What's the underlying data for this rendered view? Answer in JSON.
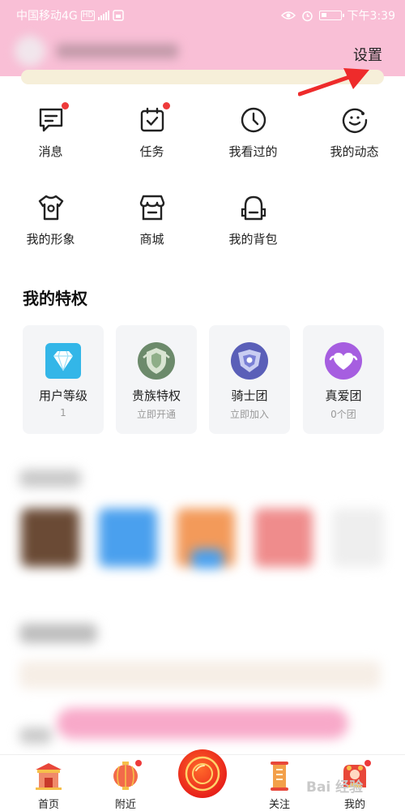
{
  "status_bar": {
    "carrier": "中国移动4G",
    "hd": "HD",
    "time": "下午3:39"
  },
  "header": {
    "settings_label": "设置"
  },
  "menu": [
    {
      "label": "消息",
      "icon": "message-icon",
      "dot": true
    },
    {
      "label": "任务",
      "icon": "task-icon",
      "dot": true
    },
    {
      "label": "我看过的",
      "icon": "history-clock-icon",
      "dot": false
    },
    {
      "label": "我的动态",
      "icon": "moments-icon",
      "dot": false
    },
    {
      "label": "我的形象",
      "icon": "avatar-shirt-icon",
      "dot": false
    },
    {
      "label": "商城",
      "icon": "shop-icon",
      "dot": false
    },
    {
      "label": "我的背包",
      "icon": "backpack-icon",
      "dot": false
    }
  ],
  "privileges": {
    "title": "我的特权",
    "cards": [
      {
        "label": "用户等级",
        "sub": "1",
        "icon": "diamond-icon",
        "color": "#33b6e8"
      },
      {
        "label": "贵族特权",
        "sub": "立即开通",
        "icon": "noble-shield-icon",
        "color": "#6c8a6b"
      },
      {
        "label": "骑士团",
        "sub": "立即加入",
        "icon": "knight-badge-icon",
        "color": "#5a5fb8"
      },
      {
        "label": "真爱团",
        "sub": "0个团",
        "icon": "heart-group-icon",
        "color": "#a65ee0"
      }
    ]
  },
  "bottom_nav": [
    {
      "label": "首页",
      "icon": "home-temple-icon",
      "dot": false
    },
    {
      "label": "附近",
      "icon": "nearby-lantern-icon",
      "dot": true
    },
    {
      "label": "",
      "icon": "live-camera-icon",
      "dot": false
    },
    {
      "label": "关注",
      "icon": "follow-scroll-icon",
      "dot": false
    },
    {
      "label": "我的",
      "icon": "mine-profile-icon",
      "dot": true
    }
  ],
  "watermark": "Bai 经验"
}
